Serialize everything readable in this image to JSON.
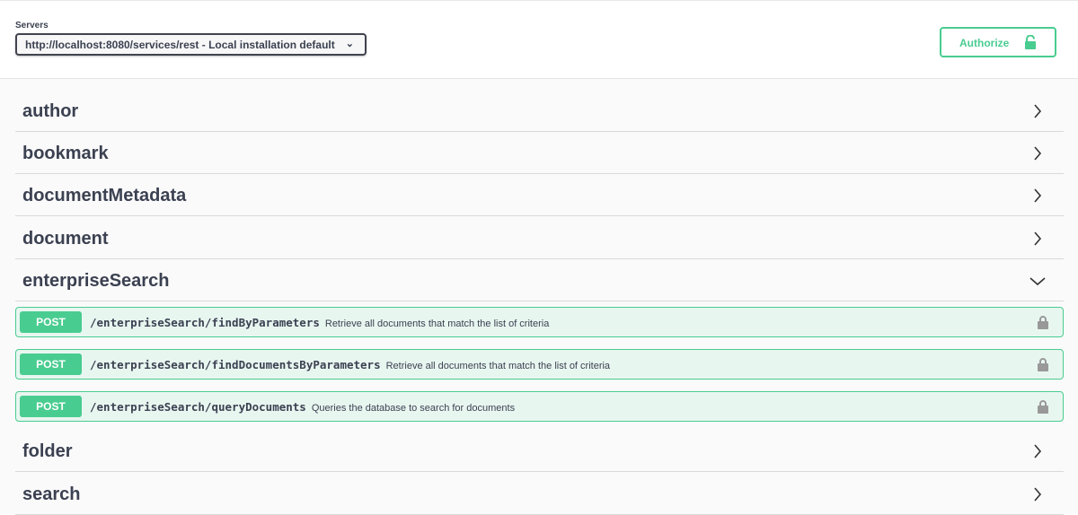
{
  "servers": {
    "label": "Servers",
    "selected": "http://localhost:8080/services/rest - Local installation default"
  },
  "authorize": {
    "label": "Authorize",
    "icon": "unlocked-icon"
  },
  "colors": {
    "post": "#49cc90",
    "post_bg": "#e8f6f0",
    "text": "#3b4151"
  },
  "tags": [
    {
      "name": "author",
      "expanded": false
    },
    {
      "name": "bookmark",
      "expanded": false
    },
    {
      "name": "documentMetadata",
      "expanded": false
    },
    {
      "name": "document",
      "expanded": false
    },
    {
      "name": "enterpriseSearch",
      "expanded": true
    },
    {
      "name": "folder",
      "expanded": false
    },
    {
      "name": "search",
      "expanded": false
    }
  ],
  "operations": [
    {
      "method": "POST",
      "path": "/enterpriseSearch/findByParameters",
      "summary": "Retrieve all documents that match the list of criteria"
    },
    {
      "method": "POST",
      "path": "/enterpriseSearch/findDocumentsByParameters",
      "summary": "Retrieve all documents that match the list of criteria"
    },
    {
      "method": "POST",
      "path": "/enterpriseSearch/queryDocuments",
      "summary": "Queries the database to search for documents"
    }
  ]
}
